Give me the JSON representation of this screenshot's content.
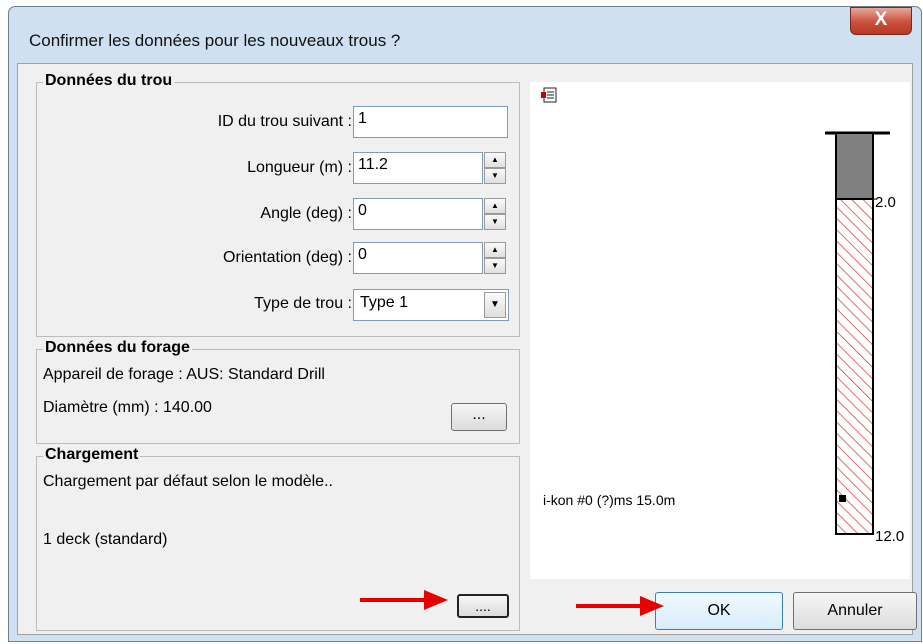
{
  "window": {
    "title": "Confirmer les données pour les nouveaux trous ?",
    "close_label": "X"
  },
  "hole_data": {
    "legend": "Données du trou",
    "next_id_label": "ID du trou suivant :",
    "next_id_value": "1",
    "length_label": "Longueur (m) :",
    "length_value": "11.2",
    "angle_label": "Angle (deg) :",
    "angle_value": "0",
    "orientation_label": "Orientation (deg) :",
    "orientation_value": "0",
    "type_label": "Type de trou :",
    "type_value": "Type 1"
  },
  "drill_data": {
    "legend": "Données du forage",
    "rig_text": "Appareil de forage : AUS: Standard Drill",
    "diameter_text": "Diamètre (mm) : 140.00",
    "browse_label": "..."
  },
  "charging": {
    "legend": "Chargement",
    "default_text": "Chargement par défaut selon le modèle..",
    "deck_text": "1 deck (standard)",
    "browse_label": "...."
  },
  "preview": {
    "stemming_label": "2.0",
    "bottom_label": "12.0",
    "primer_text": "i-kon #0 (?)ms 15.0m"
  },
  "buttons": {
    "ok": "OK",
    "cancel": "Annuler"
  },
  "colors": {
    "arrow": "#e60000",
    "charge_hatch": "#e03c3c",
    "stemming": "#808080"
  }
}
